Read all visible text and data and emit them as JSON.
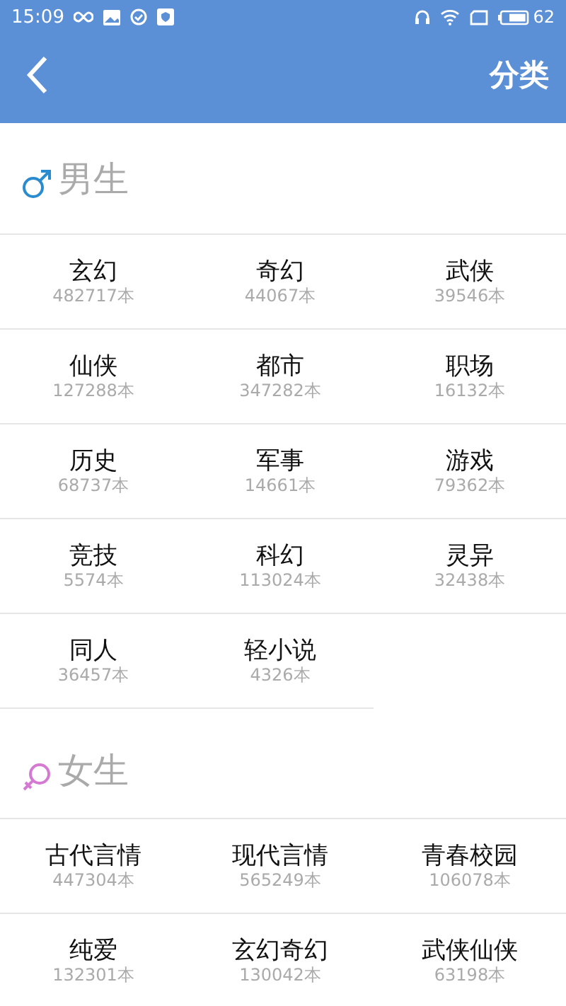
{
  "status_bar": {
    "time": "15:09",
    "battery": "62"
  },
  "header": {
    "title": "分类"
  },
  "sections": [
    {
      "kind": "male",
      "title": "男生",
      "items": [
        {
          "name": "玄幻",
          "count": "482717本"
        },
        {
          "name": "奇幻",
          "count": "44067本"
        },
        {
          "name": "武侠",
          "count": "39546本"
        },
        {
          "name": "仙侠",
          "count": "127288本"
        },
        {
          "name": "都市",
          "count": "347282本"
        },
        {
          "name": "职场",
          "count": "16132本"
        },
        {
          "name": "历史",
          "count": "68737本"
        },
        {
          "name": "军事",
          "count": "14661本"
        },
        {
          "name": "游戏",
          "count": "79362本"
        },
        {
          "name": "竞技",
          "count": "5574本"
        },
        {
          "name": "科幻",
          "count": "113024本"
        },
        {
          "name": "灵异",
          "count": "32438本"
        },
        {
          "name": "同人",
          "count": "36457本"
        },
        {
          "name": "轻小说",
          "count": "4326本"
        }
      ]
    },
    {
      "kind": "female",
      "title": "女生",
      "items": [
        {
          "name": "古代言情",
          "count": "447304本"
        },
        {
          "name": "现代言情",
          "count": "565249本"
        },
        {
          "name": "青春校园",
          "count": "106078本"
        },
        {
          "name": "纯爱",
          "count": "132301本"
        },
        {
          "name": "玄幻奇幻",
          "count": "130042本"
        },
        {
          "name": "武侠仙侠",
          "count": "63198本"
        }
      ]
    }
  ]
}
